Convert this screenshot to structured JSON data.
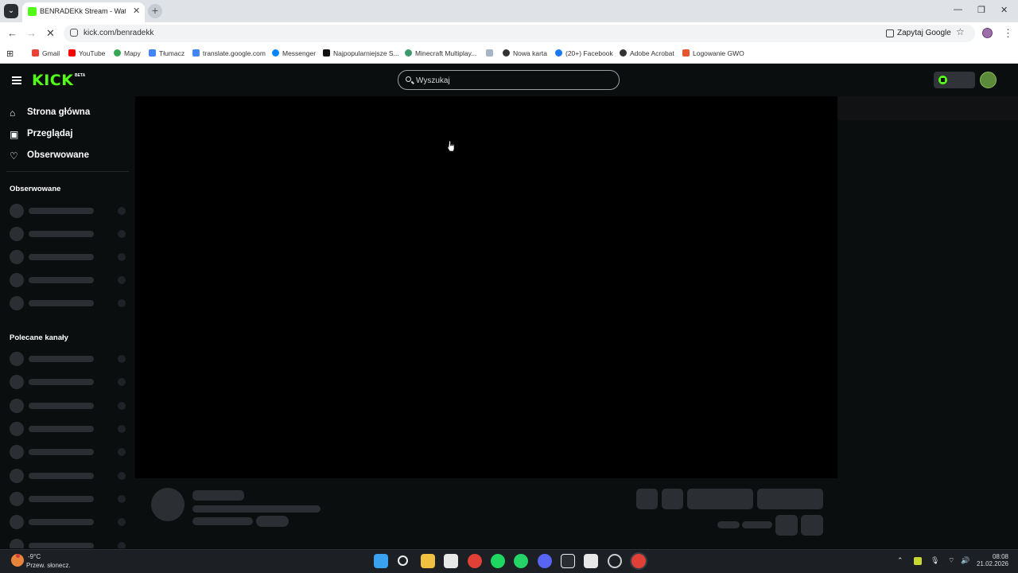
{
  "browser": {
    "tab_title": "BENRADEKk Stream - Watch Live on Kick",
    "url": "kick.com/benradekk",
    "google_button": "Zapytaj Google",
    "bookmarks": [
      "Gmail",
      "YouTube",
      "Mapy",
      "Tłumacz",
      "translate.google.com",
      "Messenger",
      "Najpopularniejsze S...",
      "Minecraft Multiplay...",
      "",
      "Nowa karta",
      "(20+) Facebook",
      "Adobe Acrobat",
      "Logowanie GWO"
    ]
  },
  "header": {
    "logo": "KICK",
    "logo_badge": "BETA",
    "search_placeholder": "Wyszukaj"
  },
  "sidebar": {
    "nav": [
      {
        "label": "Strona główna",
        "icon": "home-icon"
      },
      {
        "label": "Przeglądaj",
        "icon": "browse-icon"
      },
      {
        "label": "Obserwowane",
        "icon": "heart-icon"
      }
    ],
    "following_heading": "Obserwowane",
    "recommended_heading": "Polecane kanały"
  },
  "taskbar": {
    "temperature": "-9°C",
    "weather": "Przew. słonecz.",
    "time": "08:08",
    "date": "21.02.2026"
  }
}
